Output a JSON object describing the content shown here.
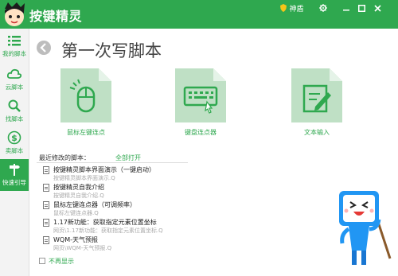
{
  "app": {
    "title": "按键精灵",
    "vip_label": "神盾"
  },
  "sidebar": {
    "items": [
      {
        "label": "我的脚本",
        "icon": "list-icon"
      },
      {
        "label": "云脚本",
        "icon": "cloud-icon"
      },
      {
        "label": "找脚本",
        "icon": "search-icon"
      },
      {
        "label": "卖脚本",
        "icon": "dollar-icon"
      },
      {
        "label": "快速引导",
        "icon": "signpost-icon",
        "active": true
      }
    ]
  },
  "main": {
    "title": "第一次写脚本",
    "tiles": [
      {
        "label": "鼠标左键连点",
        "icon": "mouse-icon"
      },
      {
        "label": "键盘连点器",
        "icon": "keyboard-icon"
      },
      {
        "label": "文本输入",
        "icon": "edit-icon"
      }
    ],
    "recent": {
      "header": "最近修改的脚本：",
      "open_all": "全部打开",
      "items": [
        {
          "name": "按键精灵脚本界面演示（一键启动）",
          "path": "按键精灵脚本界面演示.Q"
        },
        {
          "name": "按键精灵自我介绍",
          "path": "按键精灵自我介绍.Q"
        },
        {
          "name": "鼠标左键连点器（可调频率）",
          "path": "鼠标左键连点器.Q"
        },
        {
          "name": "1.17新功能：获取指定元素位置坐标",
          "path": "网页\\1.17新功能：获取指定元素位置坐标.Q"
        },
        {
          "name": "WQM-天气预报",
          "path": "网页\\WQM-天气预报.Q"
        }
      ]
    },
    "no_show": "不再显示"
  },
  "colors": {
    "brand": "#2fa84f",
    "tile": "#bfe0c5"
  }
}
